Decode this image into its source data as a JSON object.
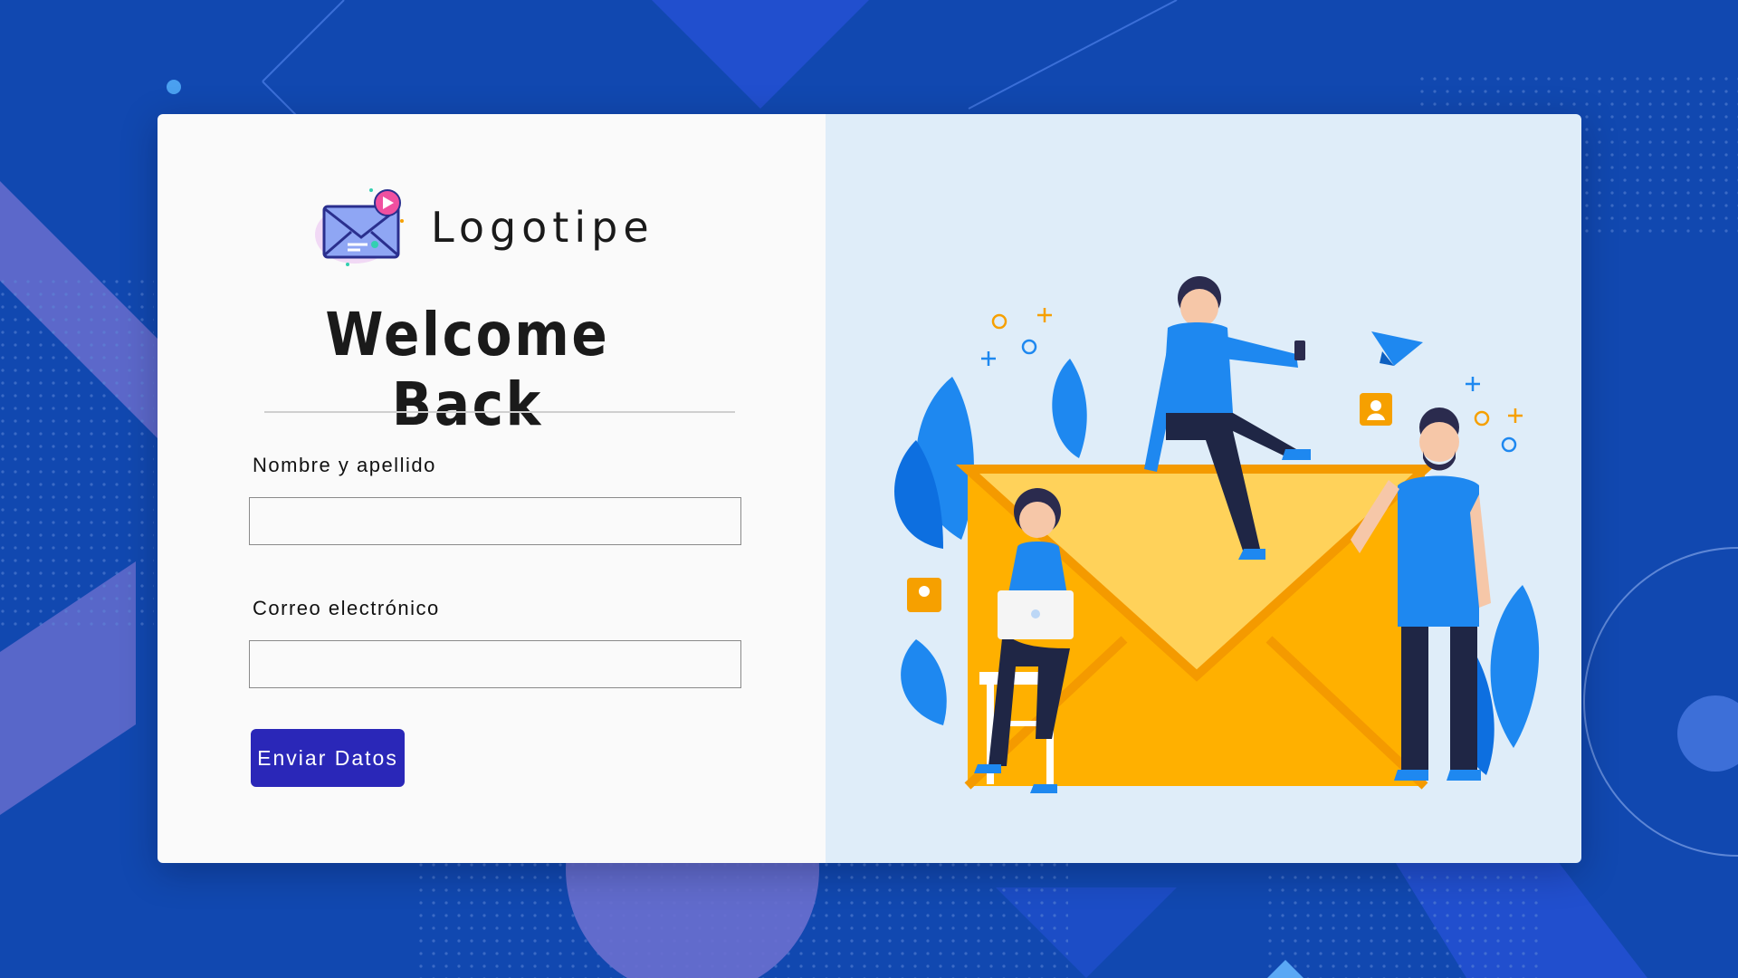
{
  "brand": {
    "logo_text": "Logotipe",
    "logo_icon": "envelope-send-icon"
  },
  "form": {
    "title": "Welcome Back",
    "name_label": "Nombre y apellido",
    "name_value": "",
    "email_label": "Correo electrónico",
    "email_value": "",
    "submit_label": "Enviar Datos"
  },
  "colors": {
    "background": "#1148b0",
    "card_left": "#fafafa",
    "card_right": "#dfedf9",
    "button": "#2a27b8",
    "envelope": "#ffb000",
    "accent_blue": "#1e88f0"
  },
  "illustration": {
    "subject": "people-around-envelope-illustration"
  }
}
